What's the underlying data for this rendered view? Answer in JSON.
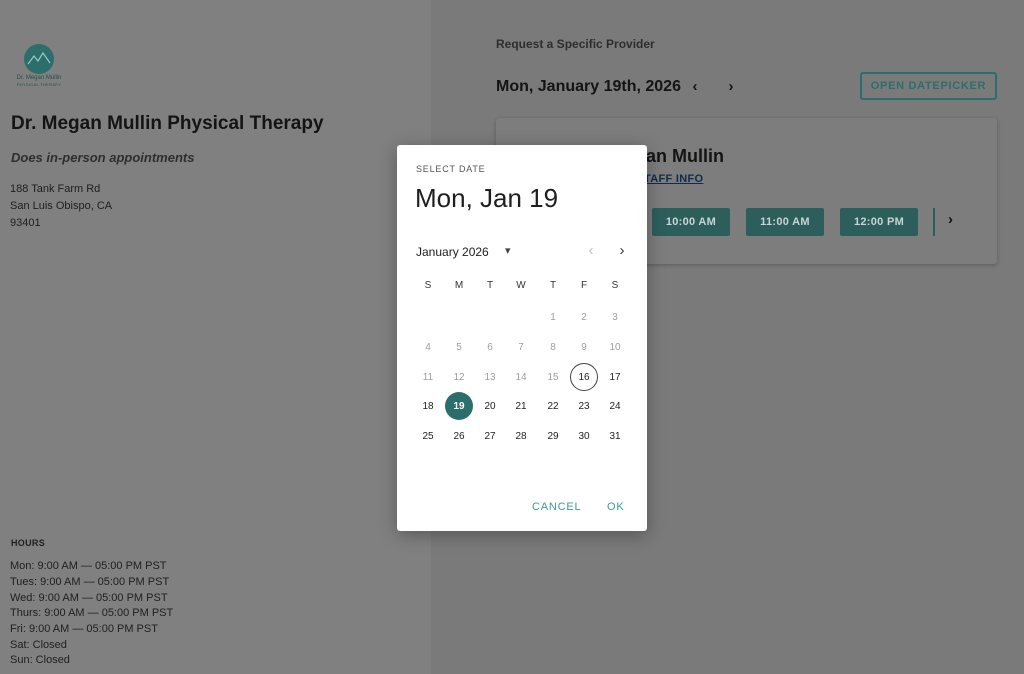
{
  "logo": {
    "line1": "Dr. Megan Mullin",
    "line2": "PHYSICAL THERAPY"
  },
  "practice": {
    "name": "Dr. Megan Mullin Physical Therapy",
    "appointment_type": "Does in-person appointments",
    "address": [
      "188 Tank Farm Rd",
      "San Luis Obispo, CA",
      "93401"
    ]
  },
  "hours": {
    "title": "HOURS",
    "lines": [
      "Mon: 9:00 AM — 05:00 PM PST",
      "Tues: 9:00 AM — 05:00 PM PST",
      "Wed: 9:00 AM — 05:00 PM PST",
      "Thurs: 9:00 AM — 05:00 PM PST",
      "Fri: 9:00 AM — 05:00 PM PST",
      "Sat: Closed",
      "Sun: Closed"
    ]
  },
  "scheduler": {
    "heading": "Request a Specific Provider",
    "date_title": "Mon, January 19th, 2026",
    "prev_icon": "‹",
    "next_icon": "›",
    "open_datepicker": "OPEN DATEPICKER",
    "provider_name": "Dr. Megan Mullin",
    "provider_name_visible": "an Mullin",
    "staff_info": "STAFF INFO",
    "staff_info_visible": "TAFF INFO",
    "slots": [
      "10:00 AM",
      "11:00 AM",
      "12:00 PM"
    ],
    "slots_next_icon": "›"
  },
  "datepicker": {
    "label": "SELECT DATE",
    "selected_date": "Mon, Jan 19",
    "month_label": "January 2026",
    "caret_icon": "▾",
    "prev_month_icon": "‹",
    "next_month_icon": "›",
    "weekdays": [
      "S",
      "M",
      "T",
      "W",
      "T",
      "F",
      "S"
    ],
    "weeks": [
      [
        "",
        "",
        "",
        "",
        "1",
        "2",
        "3"
      ],
      [
        "4",
        "5",
        "6",
        "7",
        "8",
        "9",
        "10"
      ],
      [
        "11",
        "12",
        "13",
        "14",
        "15",
        "16",
        "17"
      ],
      [
        "18",
        "19",
        "20",
        "21",
        "22",
        "23",
        "24"
      ],
      [
        "25",
        "26",
        "27",
        "28",
        "29",
        "30",
        "31"
      ]
    ],
    "today": "16",
    "selected": "19",
    "cancel_label": "CANCEL",
    "ok_label": "OK"
  },
  "colors": {
    "accent": "#2c6e6c",
    "dialog_button": "#3a9a96",
    "overlay_left": "#808080",
    "overlay_right": "#7a7a7a"
  }
}
